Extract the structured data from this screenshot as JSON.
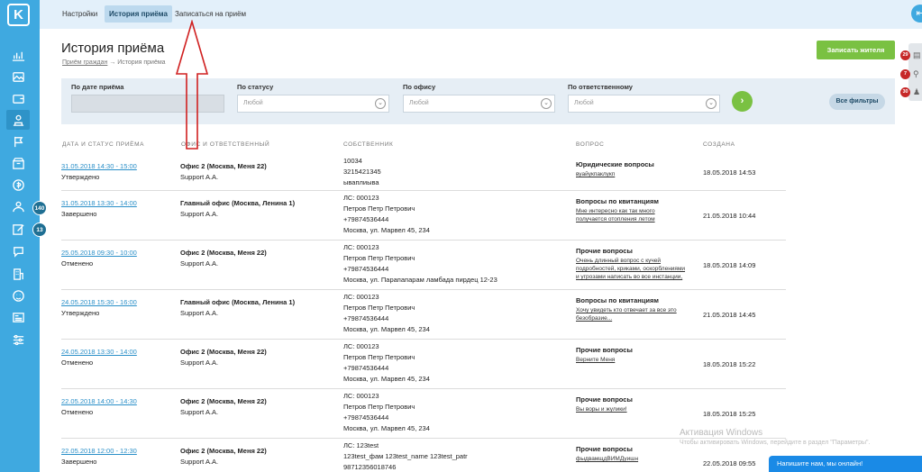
{
  "app": {
    "logo_letter": "K"
  },
  "tabs": [
    {
      "label": "Настройки",
      "active": false
    },
    {
      "label": "История приёма",
      "active": true
    },
    {
      "label": "Записаться на приём",
      "active": false
    }
  ],
  "sidebar": {
    "badges": [
      "140",
      "13"
    ]
  },
  "page": {
    "title": "История приёма",
    "breadcrumb_link": "Приём граждан",
    "breadcrumb_current": "→ История приёма",
    "add_button": "Записать жителя"
  },
  "right_badges": [
    "29",
    "7",
    "30"
  ],
  "filters": {
    "date_label": "По дате приёма",
    "status_label": "По статусу",
    "status_value": "Любой",
    "office_label": "По офису",
    "office_value": "Любой",
    "resp_label": "По ответственному",
    "resp_value": "Любой",
    "all_filters": "Все фильтры"
  },
  "table": {
    "headers": [
      "ДАТА И СТАТУС ПРИЁМА",
      "ОФИС И ОТВЕТСТВЕННЫЙ",
      "СОБСТВЕННИК",
      "ВОПРОС",
      "СОЗДАНА"
    ],
    "rows": [
      {
        "date": "31.05.2018 14:30 - 15:00",
        "status": "Утверждено",
        "office": "Офис 2 (Москва, Меня 22)",
        "resp": "Support A.A.",
        "owner": [
          "10034",
          "3215421345",
          "ываплиыва"
        ],
        "question": "Юридические вопросы",
        "q_text": [
          "вуайукпаклукп"
        ],
        "created": "18.05.2018 14:53"
      },
      {
        "date": "31.05.2018 13:30 - 14:00",
        "status": "Завершено",
        "office": "Главный офис (Москва, Ленина 1)",
        "resp": "Support A.A.",
        "owner": [
          "ЛС: 000123",
          "Петров Петр Петрович",
          "+79874536444",
          "Москва, ул. Марвел 45, 234"
        ],
        "question": "Вопросы по квитанциям",
        "q_text": [
          "Мне интересно как так много",
          "получается отопления летом"
        ],
        "created": "21.05.2018 10:44"
      },
      {
        "date": "25.05.2018 09:30 - 10:00",
        "status": "Отменено",
        "office": "Офис 2 (Москва, Меня 22)",
        "resp": "Support A.A.",
        "owner": [
          "ЛС: 000123",
          "Петров Петр Петрович",
          "+79874536444",
          "Москва, ул. Парапапарам ламбада пирдец 12-23"
        ],
        "question": "Прочие вопросы",
        "q_text": [
          "Очень длинный вопрос с кучей",
          "подробностей, криками, оскорблениями",
          "и угрозами написать во все инстанции,"
        ],
        "created": "18.05.2018 14:09"
      },
      {
        "date": "24.05.2018 15:30 - 16:00",
        "status": "Утверждено",
        "office": "Главный офис (Москва, Ленина 1)",
        "resp": "Support A.A.",
        "owner": [
          "ЛС: 000123",
          "Петров Петр Петрович",
          "+79874536444",
          "Москва, ул. Марвел 45, 234"
        ],
        "question": "Вопросы по квитанциям",
        "q_text": [
          "Хочу увидеть кто отвечает за все это",
          "безобразие..."
        ],
        "created": "21.05.2018 14:45"
      },
      {
        "date": "24.05.2018 13:30 - 14:00",
        "status": "Отменено",
        "office": "Офис 2 (Москва, Меня 22)",
        "resp": "Support A.A.",
        "owner": [
          "ЛС: 000123",
          "Петров Петр Петрович",
          "+79874536444",
          "Москва, ул. Марвел 45, 234"
        ],
        "question": "Прочие вопросы",
        "q_text": [
          "Верните Меня"
        ],
        "created": "18.05.2018 15:22"
      },
      {
        "date": "22.05.2018 14:00 - 14:30",
        "status": "Отменено",
        "office": "Офис 2 (Москва, Меня 22)",
        "resp": "Support A.A.",
        "owner": [
          "ЛС: 000123",
          "Петров Петр Петрович",
          "+79874536444",
          "Москва, ул. Марвел 45, 234"
        ],
        "question": "Прочие вопросы",
        "q_text": [
          "Вы воры и жулики!"
        ],
        "created": "18.05.2018 15:25"
      },
      {
        "date": "22.05.2018 12:00 - 12:30",
        "status": "Завершено",
        "office": "Офис 2 (Москва, Меня 22)",
        "resp": "Support A.A.",
        "owner": [
          "ЛС: 123test",
          "123test_фам 123test_name 123test_patr",
          "98712356018746"
        ],
        "question": "Прочие вопросы",
        "q_text": [
          "фыдвамщдВИМДуишн"
        ],
        "created": "22.05.2018 09:55"
      }
    ]
  },
  "watermark": {
    "line1": "Активация Windows",
    "line2": "Чтобы активировать Windows, перейдите в раздел \"Параметры\"."
  },
  "chat": {
    "label": "Напишите нам, мы онлайн!"
  }
}
